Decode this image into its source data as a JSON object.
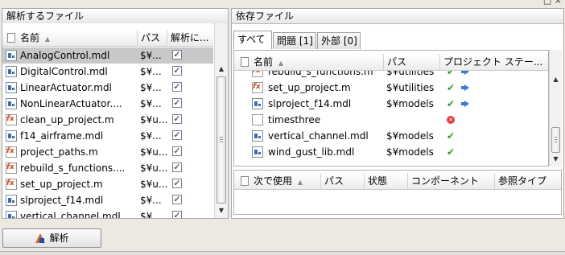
{
  "window": {
    "controls": "□ ×"
  },
  "left": {
    "title": "解析するファイル",
    "columns": {
      "name": "名前",
      "path": "パス",
      "analyze": "解析に..."
    },
    "rows": [
      {
        "name": "AnalogControl.mdl",
        "path": "$¥...",
        "type": "mdl",
        "checked": "✓"
      },
      {
        "name": "DigitalControl.mdl",
        "path": "$¥...",
        "type": "mdl",
        "checked": "✓"
      },
      {
        "name": "LinearActuator.mdl",
        "path": "$¥...",
        "type": "mdl",
        "checked": "✓"
      },
      {
        "name": "NonLinearActuator....",
        "path": "$¥...",
        "type": "mdl",
        "checked": "✓"
      },
      {
        "name": "clean_up_project.m",
        "path": "$¥u...",
        "type": "m",
        "checked": "✓"
      },
      {
        "name": "f14_airframe.mdl",
        "path": "$¥...",
        "type": "mdl",
        "checked": "✓"
      },
      {
        "name": "project_paths.m",
        "path": "$¥u...",
        "type": "m",
        "checked": "✓"
      },
      {
        "name": "rebuild_s_functions....",
        "path": "$¥u...",
        "type": "m",
        "checked": "✓"
      },
      {
        "name": "set_up_project.m",
        "path": "$¥u...",
        "type": "m",
        "checked": "✓"
      },
      {
        "name": "slproject_f14.mdl",
        "path": "$¥...",
        "type": "mdl",
        "checked": "✓"
      },
      {
        "name": "vertical_channel.mdl",
        "path": "$¥...",
        "type": "mdl",
        "checked": "✓"
      }
    ],
    "scroll": {
      "up": "▲",
      "down": "▼"
    }
  },
  "right": {
    "title": "依存ファイル",
    "tabs": [
      "すべて",
      "問題 [1]",
      "外部 [0]"
    ],
    "columns": {
      "name": "名前",
      "path": "パス",
      "status": "プロジェクト ステー..."
    },
    "rows": [
      {
        "name": "rebuild_s_functions.m",
        "path": "$¥utilities",
        "type": "m",
        "status": "ok-arrow"
      },
      {
        "name": "set_up_project.m",
        "path": "$¥utilities",
        "type": "m",
        "status": "ok-arrow"
      },
      {
        "name": "slproject_f14.mdl",
        "path": "$¥models",
        "type": "mdl",
        "status": "ok-arrow"
      },
      {
        "name": "timesthree",
        "path": "",
        "type": "none",
        "status": "error"
      },
      {
        "name": "vertical_channel.mdl",
        "path": "$¥models",
        "type": "mdl",
        "status": "ok"
      },
      {
        "name": "wind_gust_lib.mdl",
        "path": "$¥models",
        "type": "mdl",
        "status": "ok"
      }
    ],
    "lower_columns": {
      "used_by": "次で使用",
      "path": "パス",
      "state": "状態",
      "component": "コンポーネント",
      "ref_type": "参照タイプ"
    },
    "glyphs": {
      "ok": "✔",
      "error": "✕"
    },
    "scroll": {
      "up": "▲",
      "down": "▼"
    }
  },
  "footer": {
    "analyze_button": "解析"
  }
}
